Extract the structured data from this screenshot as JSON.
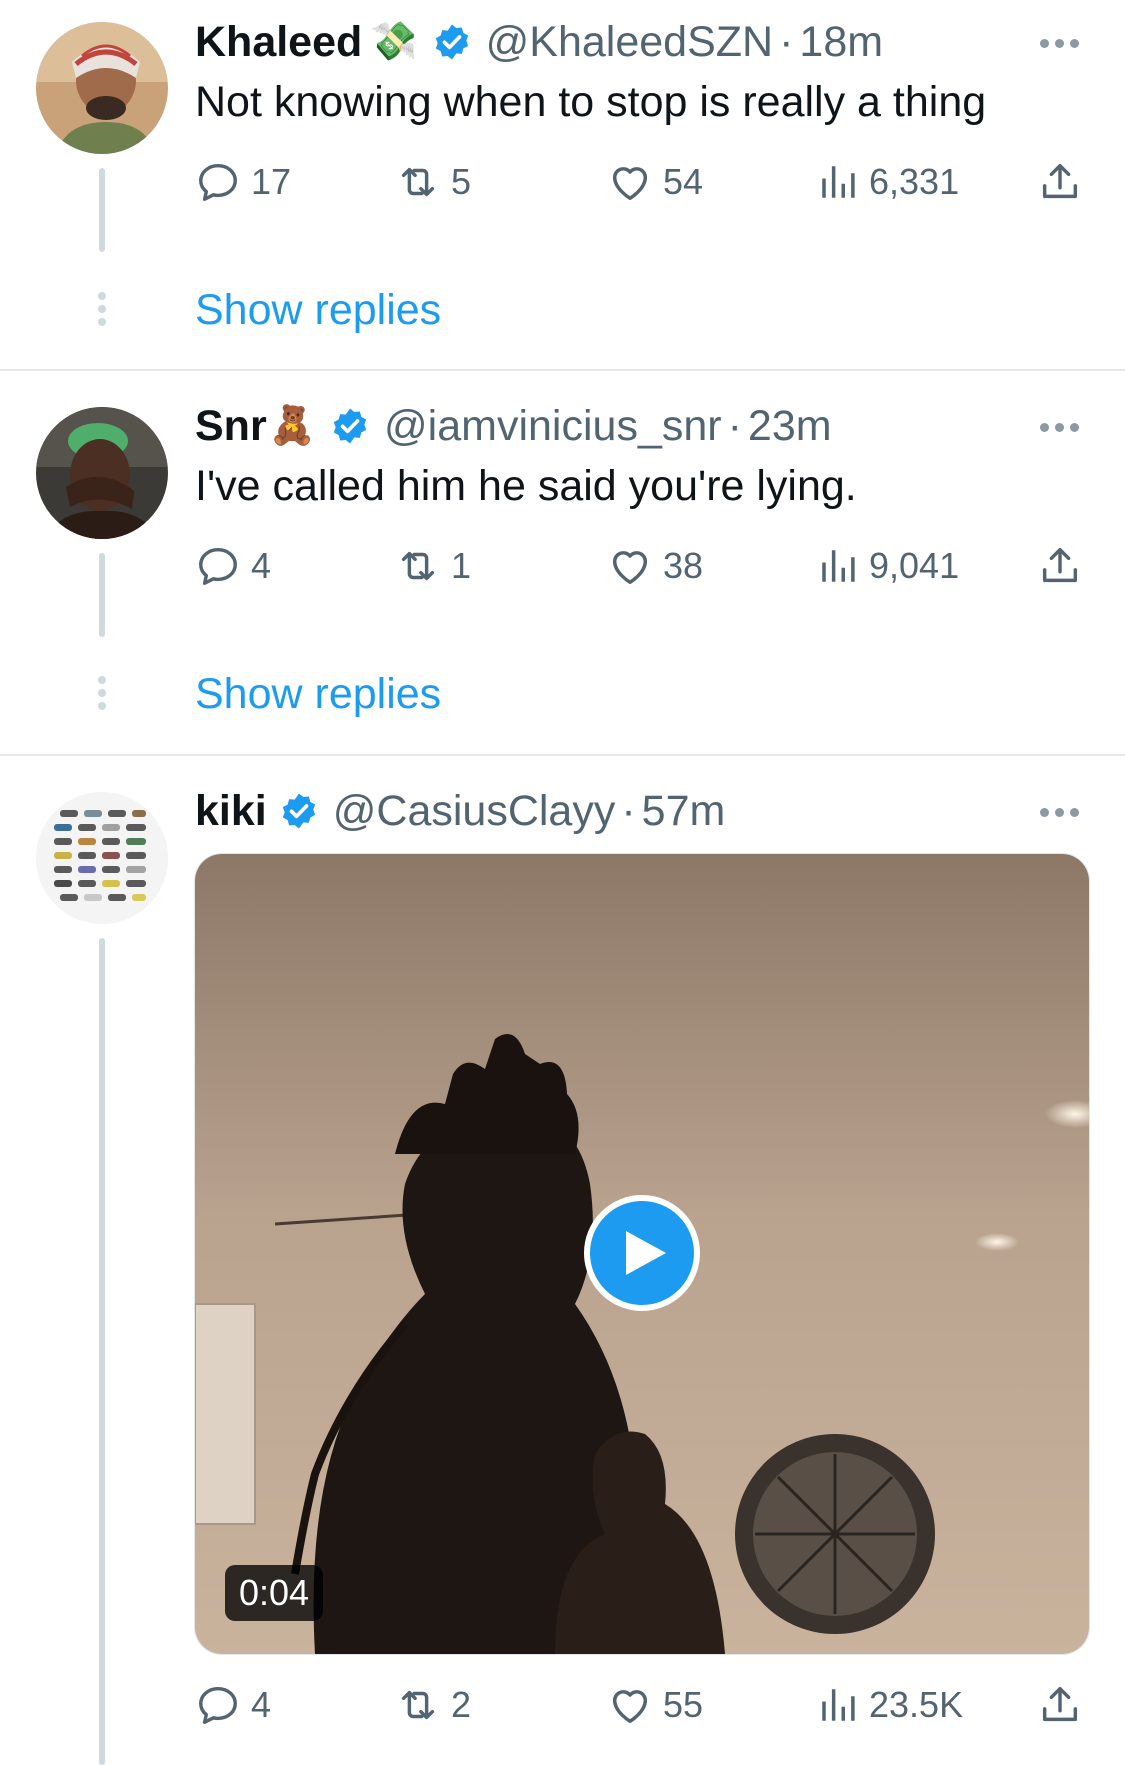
{
  "tweets": [
    {
      "name": "Khaleed",
      "name_emoji": "💸",
      "handle": "@KhaleedSZN",
      "separator": "·",
      "time": "18m",
      "text": "Not knowing when to stop is really a thing",
      "replies": "17",
      "retweets": "5",
      "likes": "54",
      "views": "6,331",
      "show_replies_label": "Show replies"
    },
    {
      "name": "Snr",
      "name_emoji": "🧸",
      "handle": "@iamvinicius_snr",
      "separator": "·",
      "time": "23m",
      "text": "I've called him he said you're lying.",
      "replies": "4",
      "retweets": "1",
      "likes": "38",
      "views": "9,041",
      "show_replies_label": "Show replies"
    },
    {
      "name": "kiki",
      "handle": "@CasiusClayy",
      "separator": "·",
      "time": "57m",
      "video_duration": "0:04",
      "replies": "4",
      "retweets": "2",
      "likes": "55",
      "views": "23.5K"
    }
  ],
  "icons": {
    "reply": "reply-icon",
    "retweet": "retweet-icon",
    "like": "like-icon",
    "views": "views-icon",
    "share": "share-icon",
    "verified": "verified-badge-icon",
    "more": "more-options-icon",
    "play": "play-icon"
  },
  "colors": {
    "link_blue": "#1d9bf0",
    "secondary_text": "#536471",
    "primary_text": "#0f1419",
    "thread_line": "#cfd9de",
    "divider": "#e6e8ea"
  }
}
